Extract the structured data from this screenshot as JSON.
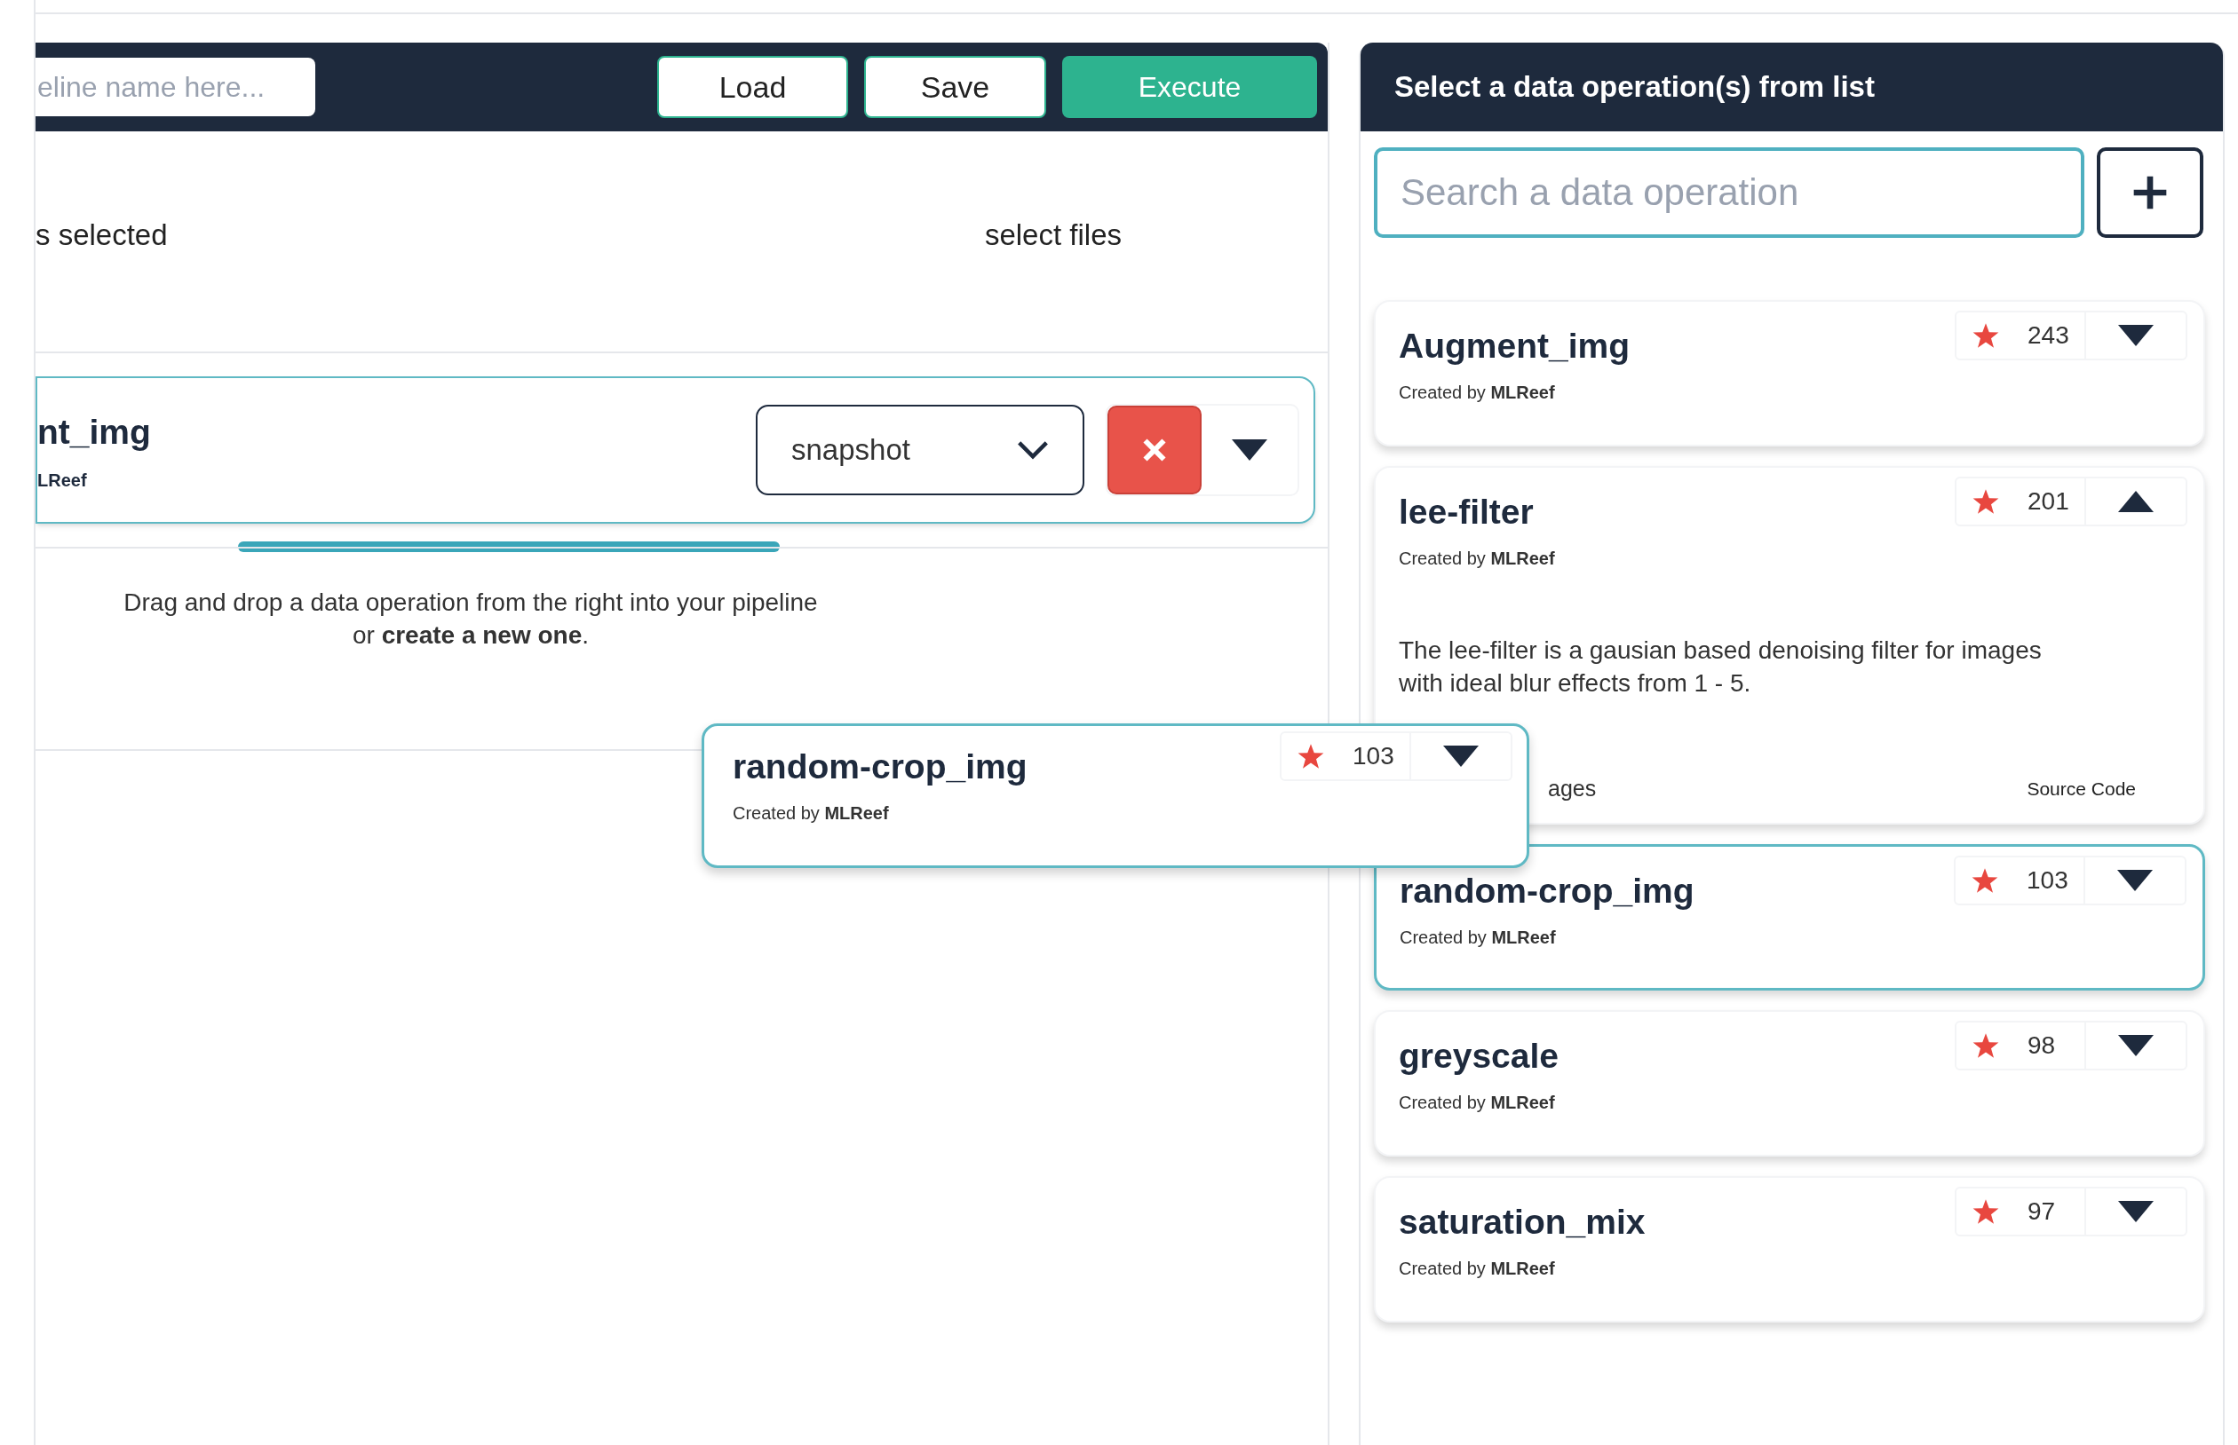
{
  "pipeline_header": {
    "name_field": {
      "placeholder": "eline name here..."
    },
    "buttons": [
      {
        "label": "Load",
        "kind": "outline"
      },
      {
        "label": "Save",
        "kind": "outline"
      },
      {
        "label": "Execute",
        "kind": "primary"
      }
    ]
  },
  "files": {
    "status": "s selected",
    "action": "select files"
  },
  "pipeline_steps": [
    {
      "title": "nt_img",
      "author": "LReef",
      "version": "snapshot",
      "expanded": false
    }
  ],
  "drop_hint": "Drag and drop a data operation from the right into your pipeline or **create a new one**.",
  "dragged_card": {
    "title": "random-crop_img",
    "created_by": "Created by **MLReef**",
    "star_count": "103",
    "expanded": false
  },
  "operations_panel": {
    "title": "Select a data operation(s) from list",
    "search": {
      "placeholder": "Search a data operation"
    },
    "operations": [
      {
        "title": "Augment_img",
        "created_by": "Created by **MLReef**",
        "star_count": "243",
        "expanded": false,
        "selected": false
      },
      {
        "title": "lee-filter",
        "created_by": "Created by **MLReef**",
        "star_count": "201",
        "expanded": true,
        "selected": false,
        "description": "The lee-filter is a gausian based denoising filter for images with ideal blur effects from 1 - 5.",
        "links": [
          "ages",
          "Source Code"
        ]
      },
      {
        "title": "random-crop_img",
        "created_by": "Created by **MLReef**",
        "star_count": "103",
        "expanded": false,
        "selected": true
      },
      {
        "title": "greyscale",
        "created_by": "Created by **MLReef**",
        "star_count": "98",
        "expanded": false,
        "selected": false
      },
      {
        "title": "saturation_mix",
        "created_by": "Created by **MLReef**",
        "star_count": "97",
        "expanded": false,
        "selected": false
      }
    ]
  }
}
